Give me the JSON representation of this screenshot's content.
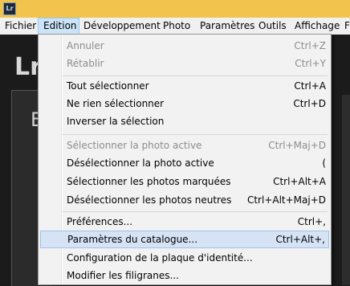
{
  "window": {
    "app_icon_text": "Lr"
  },
  "menubar": {
    "items": [
      {
        "label": "Fichier"
      },
      {
        "label": "Edition"
      },
      {
        "label": "Développement"
      },
      {
        "label": "Photo"
      },
      {
        "label": "Paramètres"
      },
      {
        "label": "Outils"
      },
      {
        "label": "Affichage"
      },
      {
        "label": "F"
      }
    ]
  },
  "background": {
    "logo_text": "Lr",
    "panel_text": "E"
  },
  "edition_menu": {
    "items": [
      {
        "label": "Annuler",
        "shortcut": "Ctrl+Z"
      },
      {
        "label": "Rétablir",
        "shortcut": "Ctrl+Y"
      },
      {
        "label": "Tout sélectionner",
        "shortcut": "Ctrl+A"
      },
      {
        "label": "Ne rien sélectionner",
        "shortcut": "Ctrl+D"
      },
      {
        "label": "Inverser la sélection",
        "shortcut": ""
      },
      {
        "label": "Sélectionner la photo active",
        "shortcut": "Ctrl+Maj+D"
      },
      {
        "label": "Désélectionner la photo active",
        "shortcut": "("
      },
      {
        "label": "Sélectionner les photos marquées",
        "shortcut": "Ctrl+Alt+A"
      },
      {
        "label": "Désélectionner les photos neutres",
        "shortcut": "Ctrl+Alt+Maj+D"
      },
      {
        "label": "Préférences...",
        "shortcut": "Ctrl+,"
      },
      {
        "label": "Paramètres du catalogue...",
        "shortcut": "Ctrl+Alt+,"
      },
      {
        "label": "Configuration de la plaque d'identité...",
        "shortcut": ""
      },
      {
        "label": "Modifier les filigranes...",
        "shortcut": ""
      }
    ]
  }
}
